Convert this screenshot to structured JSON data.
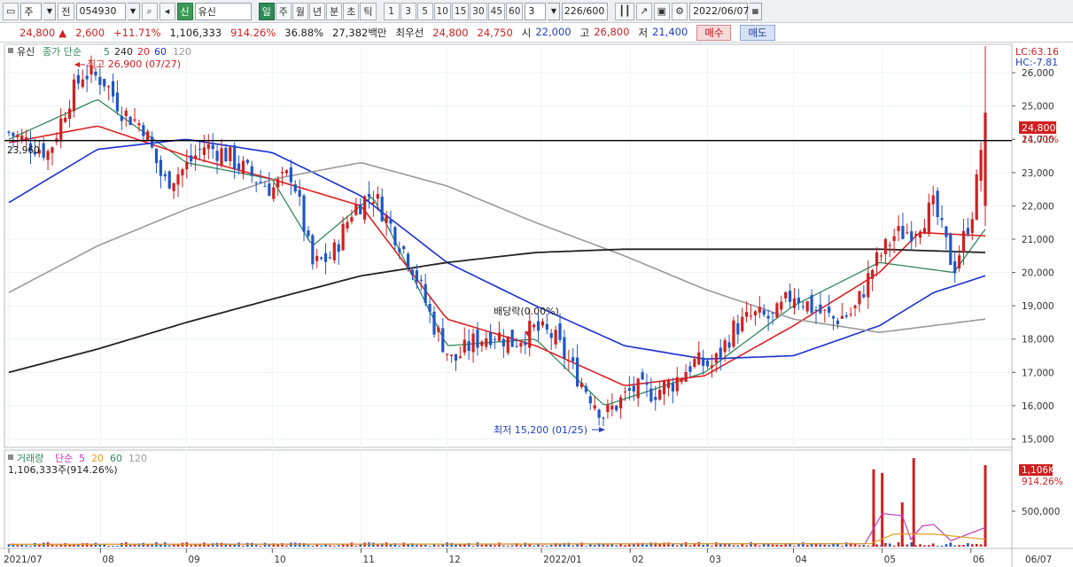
{
  "toolbar": {
    "type_label": "주",
    "front_label": "전",
    "code_value": "054930",
    "market_badge": "신",
    "stock_name": "유신",
    "period_tabs": [
      "일",
      "주",
      "월",
      "년",
      "분",
      "초",
      "틱"
    ],
    "active_period": "일",
    "minute_buttons": [
      "1",
      "3",
      "5",
      "10",
      "15",
      "30",
      "45",
      "60"
    ],
    "interval_value": "3",
    "count_display": "226/600",
    "date_value": "2022/06/07"
  },
  "quote": {
    "price": "24,800",
    "change_arrow": "▲",
    "change": "2,600",
    "change_rate": "+11.71%",
    "volume": "1,106,333",
    "volume_ratio": "914.26%",
    "turnover_ratio": "36.88%",
    "amount": "27,382백만",
    "best_ask_label": "최우선",
    "best_ask": "24,800",
    "best_bid": "24,750",
    "open_label": "시",
    "open": "22,000",
    "high_label": "고",
    "high": "26,800",
    "low_label": "저",
    "low": "21,400",
    "buy_label": "매수",
    "sell_label": "매도"
  },
  "price_panel": {
    "name": "유신",
    "legend_prefix": "종가 단순",
    "ma_labels": [
      "5",
      "240",
      "20",
      "60",
      "120"
    ],
    "lc_label": "LC:63.16",
    "hc_label": "HC:-7.81",
    "max_note": "최고 26,900 (07/27)",
    "min_note": "최저 15,200 (01/25)",
    "dividend_note": "배당락(0.00%)",
    "hline_label": "23,960",
    "last_price_tag": "24,800",
    "last_change_tag": "11.71%"
  },
  "volume_panel": {
    "legend_label": "거래량",
    "ma_prefix": "단순",
    "ma_labels": [
      "5",
      "20",
      "60",
      "120"
    ],
    "current": "1,106,333주(914.26%)",
    "last_tag": "1,106K",
    "last_tag_sub": "914.26%",
    "axis_tick": "500,000"
  },
  "x_axis": {
    "labels": [
      "2021/07",
      "08",
      "09",
      "10",
      "11",
      "12",
      "2022/01",
      "02",
      "03",
      "04",
      "05",
      "06",
      "06/07"
    ]
  },
  "colors": {
    "up": "#d21f1f",
    "down": "#1f56c8",
    "ma5": "#2f8a5a",
    "ma20": "#e02020",
    "ma60": "#1a2fd0",
    "ma120": "#9a9a9a",
    "ma240": "#222222"
  },
  "chart_data": {
    "type": "candlestick",
    "x_range": [
      "2021-07-01",
      "2022-06-07"
    ],
    "y_range": [
      14800,
      26800
    ],
    "y_ticks": [
      15000,
      16000,
      17000,
      18000,
      19000,
      20000,
      21000,
      22000,
      23000,
      24000,
      25000,
      26000
    ],
    "y_tick_labels": [
      "15,000",
      "16,000",
      "17,000",
      "18,000",
      "19,000",
      "20,000",
      "21,000",
      "22,000",
      "23,000",
      "24,000",
      "25,000",
      "26,000"
    ],
    "close_path": [
      [
        "2021-07-01",
        24200
      ],
      [
        "2021-07-08",
        23900
      ],
      [
        "2021-07-15",
        23600
      ],
      [
        "2021-07-22",
        25200
      ],
      [
        "2021-07-27",
        26000
      ],
      [
        "2021-08-03",
        25800
      ],
      [
        "2021-08-10",
        24800
      ],
      [
        "2021-08-17",
        24400
      ],
      [
        "2021-08-24",
        22700
      ],
      [
        "2021-08-31",
        23100
      ],
      [
        "2021-09-07",
        23800
      ],
      [
        "2021-09-14",
        23600
      ],
      [
        "2021-09-24",
        22900
      ],
      [
        "2021-10-01",
        22500
      ],
      [
        "2021-10-08",
        23000
      ],
      [
        "2021-10-15",
        20200
      ],
      [
        "2021-10-22",
        20500
      ],
      [
        "2021-10-29",
        21900
      ],
      [
        "2021-11-05",
        22400
      ],
      [
        "2021-11-12",
        21300
      ],
      [
        "2021-11-19",
        20200
      ],
      [
        "2021-11-26",
        18500
      ],
      [
        "2021-12-03",
        17300
      ],
      [
        "2021-12-10",
        17900
      ],
      [
        "2021-12-17",
        18200
      ],
      [
        "2021-12-24",
        17900
      ],
      [
        "2021-12-31",
        18300
      ],
      [
        "2022-01-07",
        18100
      ],
      [
        "2022-01-14",
        17100
      ],
      [
        "2022-01-21",
        16200
      ],
      [
        "2022-01-25",
        15700
      ],
      [
        "2022-02-04",
        16500
      ],
      [
        "2022-02-11",
        16400
      ],
      [
        "2022-02-18",
        16700
      ],
      [
        "2022-02-25",
        17300
      ],
      [
        "2022-03-04",
        17200
      ],
      [
        "2022-03-11",
        18300
      ],
      [
        "2022-03-18",
        18700
      ],
      [
        "2022-03-25",
        18600
      ],
      [
        "2022-04-01",
        19400
      ],
      [
        "2022-04-08",
        18900
      ],
      [
        "2022-04-15",
        18600
      ],
      [
        "2022-04-22",
        18800
      ],
      [
        "2022-04-29",
        20200
      ],
      [
        "2022-05-06",
        21100
      ],
      [
        "2022-05-13",
        21300
      ],
      [
        "2022-05-20",
        22000
      ],
      [
        "2022-05-27",
        20100
      ],
      [
        "2022-06-03",
        22000
      ],
      [
        "2022-06-07",
        24800
      ]
    ],
    "moving_averages": [
      {
        "name": "5",
        "values": [
          [
            "2021-07-01",
            24000
          ],
          [
            "2021-08-01",
            25200
          ],
          [
            "2021-09-01",
            23300
          ],
          [
            "2021-10-01",
            22800
          ],
          [
            "2021-10-15",
            20800
          ],
          [
            "2021-11-05",
            22300
          ],
          [
            "2021-12-01",
            17800
          ],
          [
            "2022-01-01",
            18000
          ],
          [
            "2022-01-25",
            16000
          ],
          [
            "2022-03-01",
            17000
          ],
          [
            "2022-04-01",
            19000
          ],
          [
            "2022-05-01",
            20300
          ],
          [
            "2022-05-27",
            20000
          ],
          [
            "2022-06-07",
            21300
          ]
        ]
      },
      {
        "name": "20",
        "values": [
          [
            "2021-07-01",
            23900
          ],
          [
            "2021-08-01",
            24400
          ],
          [
            "2021-09-01",
            23500
          ],
          [
            "2021-10-01",
            22800
          ],
          [
            "2021-11-01",
            22000
          ],
          [
            "2021-12-01",
            18600
          ],
          [
            "2022-01-01",
            17800
          ],
          [
            "2022-02-01",
            16600
          ],
          [
            "2022-03-01",
            16900
          ],
          [
            "2022-04-01",
            18400
          ],
          [
            "2022-05-01",
            20000
          ],
          [
            "2022-05-15",
            21200
          ],
          [
            "2022-06-07",
            21100
          ]
        ]
      },
      {
        "name": "60",
        "values": [
          [
            "2021-07-01",
            22100
          ],
          [
            "2021-08-01",
            23700
          ],
          [
            "2021-09-01",
            24000
          ],
          [
            "2021-10-01",
            23600
          ],
          [
            "2021-11-01",
            22300
          ],
          [
            "2021-12-01",
            20300
          ],
          [
            "2022-01-01",
            19000
          ],
          [
            "2022-02-01",
            17800
          ],
          [
            "2022-03-01",
            17400
          ],
          [
            "2022-04-01",
            17500
          ],
          [
            "2022-05-01",
            18400
          ],
          [
            "2022-05-20",
            19400
          ],
          [
            "2022-06-07",
            19900
          ]
        ]
      },
      {
        "name": "120",
        "values": [
          [
            "2021-07-01",
            19400
          ],
          [
            "2021-08-01",
            20800
          ],
          [
            "2021-09-01",
            21900
          ],
          [
            "2021-10-01",
            22800
          ],
          [
            "2021-11-01",
            23300
          ],
          [
            "2021-12-01",
            22600
          ],
          [
            "2022-01-01",
            21500
          ],
          [
            "2022-02-01",
            20500
          ],
          [
            "2022-03-01",
            19500
          ],
          [
            "2022-04-01",
            18600
          ],
          [
            "2022-05-01",
            18200
          ],
          [
            "2022-06-07",
            18600
          ]
        ]
      },
      {
        "name": "240",
        "values": [
          [
            "2021-07-01",
            17000
          ],
          [
            "2021-08-01",
            17700
          ],
          [
            "2021-09-01",
            18500
          ],
          [
            "2021-10-01",
            19200
          ],
          [
            "2021-11-01",
            19900
          ],
          [
            "2021-12-01",
            20300
          ],
          [
            "2022-01-01",
            20600
          ],
          [
            "2022-02-01",
            20700
          ],
          [
            "2022-03-01",
            20700
          ],
          [
            "2022-04-01",
            20700
          ],
          [
            "2022-05-01",
            20700
          ],
          [
            "2022-06-07",
            20600
          ]
        ]
      }
    ],
    "horizontal_line": 23960,
    "volume_spikes": [
      [
        "2022-04-29",
        1050000
      ],
      [
        "2022-05-02",
        1000000
      ],
      [
        "2022-05-09",
        600000
      ],
      [
        "2022-05-13",
        1200000
      ],
      [
        "2022-06-07",
        1106333
      ]
    ],
    "volume_ylim": [
      0,
      1250000
    ]
  }
}
